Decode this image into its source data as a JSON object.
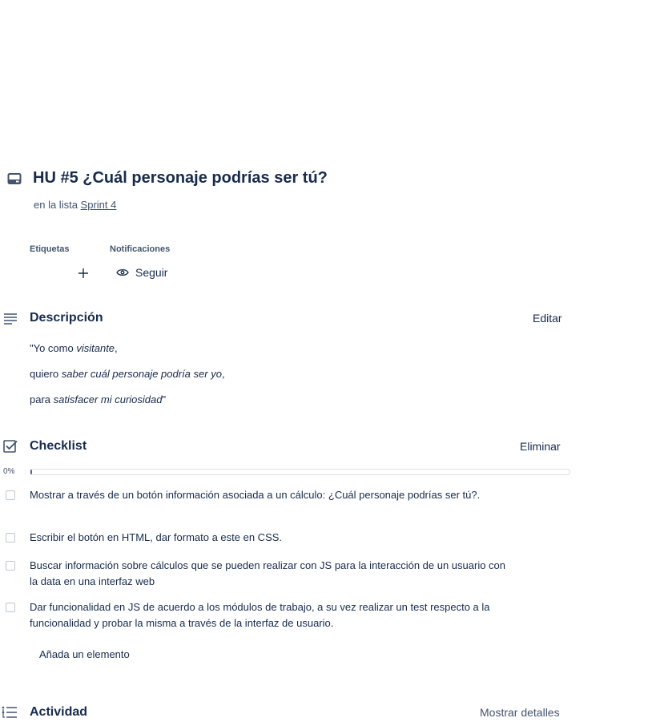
{
  "card": {
    "title": "HU #5 ¿Cuál personaje podrías ser tú?",
    "in_list_prefix": "en la lista",
    "list_name": "Sprint 4"
  },
  "labels": {
    "etiquetas": "Etiquetas",
    "notificaciones": "Notificaciones"
  },
  "notifications": {
    "follow_label": "Seguir"
  },
  "description": {
    "title": "Descripción",
    "edit_label": "Editar",
    "line1_a": "\"Yo como ",
    "line1_b": "visitante",
    "line1_c": ",",
    "line2_a": "quiero ",
    "line2_b": "saber cuál personaje podría ser yo",
    "line2_c": ",",
    "line3_a": "para ",
    "line3_b": "satisfacer mi curiosidad",
    "line3_c": "\""
  },
  "checklist": {
    "title": "Checklist",
    "delete_label": "Eliminar",
    "progress_text": "0%",
    "progress_fraction": 0,
    "items": [
      {
        "text": "Mostrar a través de un botón información asociada a un cálculo: ¿Cuál personaje podrías ser tú?.",
        "checked": false
      },
      {
        "text": "Escribir el botón en HTML, dar formato a este en CSS.",
        "checked": false
      },
      {
        "text": "Buscar información sobre cálculos que se pueden realizar con JS para la interacción de un usuario con la data en una interfaz web",
        "checked": false
      },
      {
        "text": "Dar funcionalidad en JS de acuerdo a los módulos de trabajo, a su vez realizar un test respecto a la funcionalidad y probar la misma a través de la interfaz de usuario.",
        "checked": false
      }
    ],
    "add_item_label": "Añada un elemento"
  },
  "activity": {
    "title": "Actividad",
    "show_details_label": "Mostrar detalles"
  },
  "colors": {
    "text": "#172b4d",
    "subtle": "#44546f",
    "checkbox_border": "#c1c7d0"
  }
}
